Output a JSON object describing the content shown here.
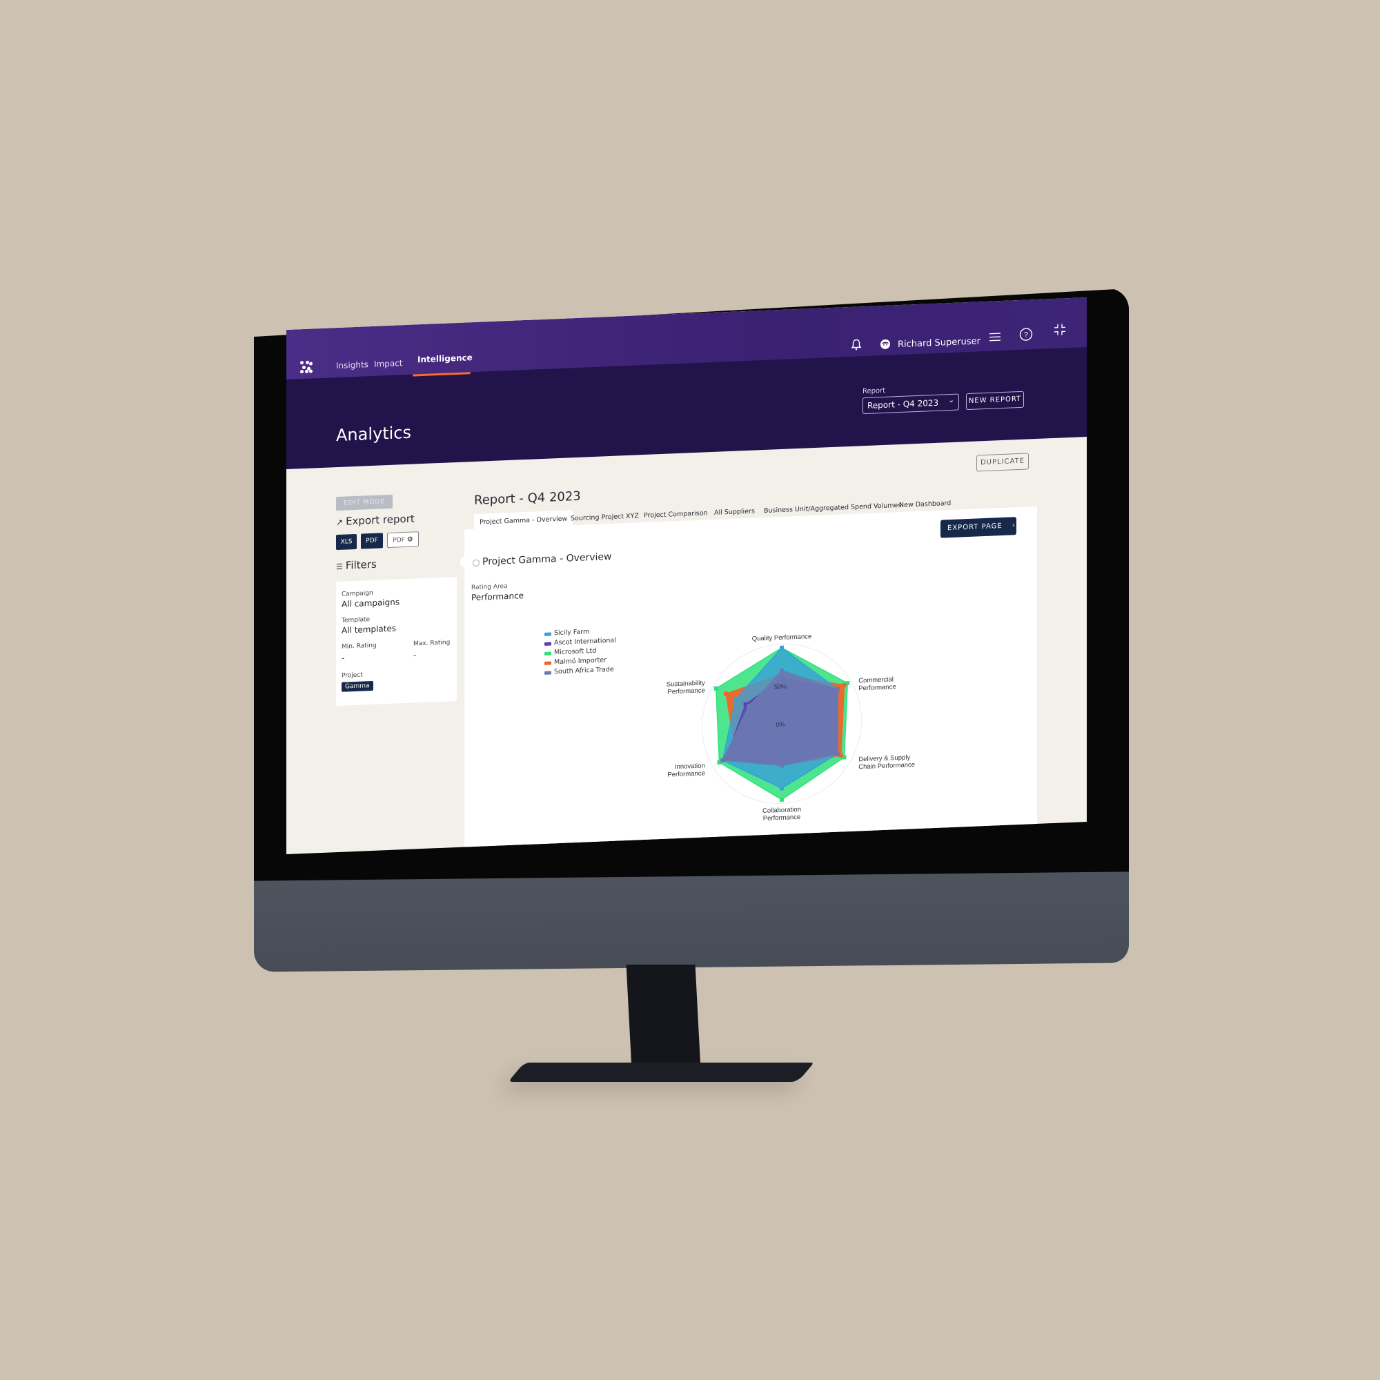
{
  "topbar": {
    "nav": [
      {
        "label": "Insights",
        "active": false
      },
      {
        "label": "Impact",
        "active": false
      },
      {
        "label": "Intelligence",
        "active": true
      }
    ],
    "username": "Richard Superuser",
    "icons": [
      "bell-icon",
      "user-avatar-icon",
      "menu-icon",
      "help-icon",
      "collapse-screen-icon"
    ],
    "report_label": "Report",
    "report_value": "Report - Q4 2023",
    "new_report": "NEW REPORT",
    "accent": "#ff6b2c"
  },
  "page": {
    "title": "Analytics",
    "duplicate": "DUPLICATE"
  },
  "sidebar": {
    "edit_mode": "EDIT MODE",
    "export_title": "Export report",
    "export_buttons": [
      "XLS",
      "PDF",
      "PDF"
    ],
    "filters_title": "Filters",
    "filters": {
      "campaign_label": "Campaign",
      "campaign_value": "All campaigns",
      "template_label": "Template",
      "template_value": "All templates",
      "min_rating_label": "Min. Rating",
      "min_rating_value": "-",
      "max_rating_label": "Max. Rating",
      "max_rating_value": "-",
      "project_label": "Project",
      "project_value": "Gamma"
    }
  },
  "main": {
    "report_title": "Report - Q4 2023",
    "tabs": [
      {
        "label": "Project Gamma - Overview",
        "active": true
      },
      {
        "label": "Sourcing Project XYZ",
        "active": false
      },
      {
        "label": "Project Comparison",
        "active": false
      },
      {
        "label": "All Suppliers",
        "active": false
      },
      {
        "label": "Business Unit/Aggregated Spend Volumes",
        "active": false
      },
      {
        "label": "New Dashboard",
        "active": false
      }
    ],
    "export_page": "EXPORT PAGE",
    "panel_title": "Project Gamma - Overview",
    "rating_area_label": "Rating Area",
    "rating_area_value": "Performance"
  },
  "chart_data": {
    "type": "radar",
    "title": "",
    "axes": [
      "Quality Performance",
      "Commercial Performance",
      "Delivery & Supply Chain Performance",
      "Collaboration Performance",
      "Innovation Performance",
      "Sustainability Performance"
    ],
    "ticks": [
      "0%",
      "50%"
    ],
    "range": [
      0,
      100
    ],
    "legend_position": "left",
    "series": [
      {
        "name": "Sicily Farm",
        "color": "#3aa0d8",
        "values": [
          100,
          85,
          85,
          85,
          90,
          70
        ]
      },
      {
        "name": "Ascot International",
        "color": "#5b3fb0",
        "values": [
          60,
          85,
          85,
          55,
          85,
          55
        ]
      },
      {
        "name": "Microsoft Ltd",
        "color": "#2ee27a",
        "values": [
          100,
          100,
          95,
          100,
          95,
          100
        ]
      },
      {
        "name": "Malmö Importer",
        "color": "#f0652a",
        "values": [
          65,
          95,
          90,
          55,
          70,
          85
        ]
      },
      {
        "name": "South Africa Trade",
        "color": "#6a7ab0",
        "values": [
          70,
          85,
          85,
          55,
          90,
          50
        ]
      }
    ]
  }
}
